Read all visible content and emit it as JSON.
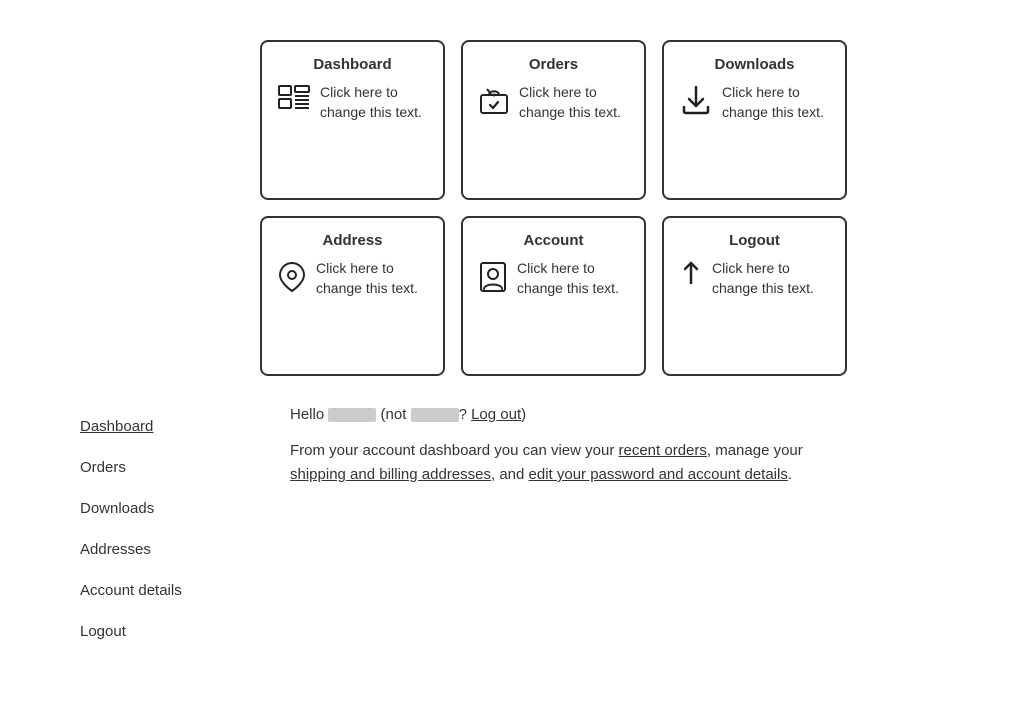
{
  "widgets": [
    {
      "id": "dashboard",
      "title": "Dashboard",
      "text": "Click here to change this text.",
      "icon": "dashboard"
    },
    {
      "id": "orders",
      "title": "Orders",
      "text": "Click here to change this text.",
      "icon": "orders"
    },
    {
      "id": "downloads",
      "title": "Downloads",
      "text": "Click here to change this text.",
      "icon": "downloads"
    },
    {
      "id": "address",
      "title": "Address",
      "text": "Click here to change this text.",
      "icon": "address"
    },
    {
      "id": "account",
      "title": "Account",
      "text": "Click here to change this text.",
      "icon": "account"
    },
    {
      "id": "logout",
      "title": "Logout",
      "text": "Click here to change this text.",
      "icon": "logout"
    }
  ],
  "sidebar": {
    "items": [
      {
        "label": "Dashboard",
        "active": true
      },
      {
        "label": "Orders",
        "active": false
      },
      {
        "label": "Downloads",
        "active": false
      },
      {
        "label": "Addresses",
        "active": false
      },
      {
        "label": "Account details",
        "active": false
      },
      {
        "label": "Logout",
        "active": false
      }
    ]
  },
  "main": {
    "hello_prefix": "Hello",
    "hello_suffix": "(not",
    "hello_question": "?",
    "logout_label": "Log out",
    "hello_end": ")",
    "dashboard_text_1": "From your account dashboard you can view your ",
    "link_orders": "recent orders",
    "dashboard_text_2": ", manage your ",
    "link_addresses": "shipping and billing addresses",
    "dashboard_text_3": ", and ",
    "link_account": "edit your password and account details",
    "dashboard_text_4": "."
  }
}
